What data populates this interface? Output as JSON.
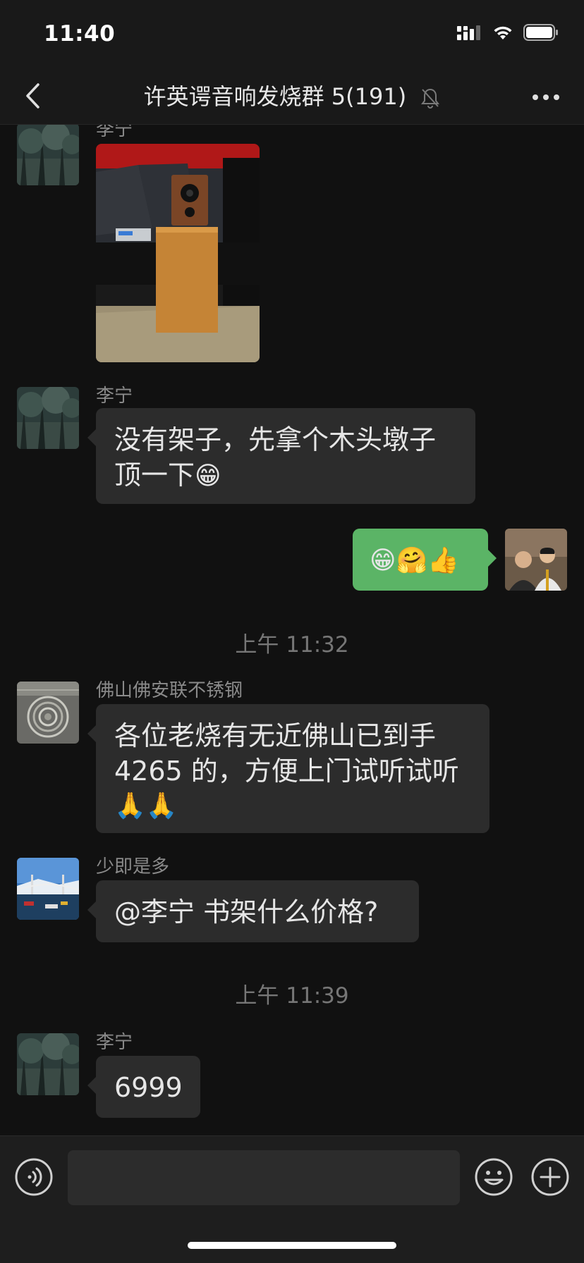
{
  "status_bar": {
    "time": "11:40",
    "icons": [
      "signal-icon",
      "wifi-icon",
      "battery-icon"
    ]
  },
  "nav": {
    "title": "许英谔音响发烧群 5(191)",
    "icons": [
      "back-chevron-icon",
      "mute-bell-icon",
      "more-dots-icon"
    ]
  },
  "messages": [
    {
      "sender": "李宁",
      "type": "image",
      "image_desc": "speaker-on-wooden-stand-photo"
    },
    {
      "sender": "李宁",
      "type": "text",
      "line1": "没有架子，先拿个木头墩子",
      "line2": "顶一下",
      "emoji": "😁"
    },
    {
      "sender": "me",
      "type": "emoji",
      "emojis": "😁🤗👍"
    },
    {
      "type": "timestamp",
      "text": "上午 11:32"
    },
    {
      "sender": "佛山佛安联不锈钢",
      "type": "text",
      "line1": "各位老烧有无近佛山已到手",
      "line2": "4265 的，方便上门试听试听",
      "line3": "🙏🙏"
    },
    {
      "sender": "少即是多",
      "type": "text",
      "text": "@李宁 书架什么价格?"
    },
    {
      "type": "timestamp",
      "text": "上午 11:39"
    },
    {
      "sender": "李宁",
      "type": "text",
      "text": "6999"
    }
  ],
  "input_bar": {
    "placeholder": "",
    "icons": [
      "voice-icon",
      "emoji-icon",
      "plus-icon"
    ]
  },
  "colors": {
    "background": "#111111",
    "bubble_other": "#2c2c2c",
    "bubble_self": "#5bb466",
    "name_text": "#8a8a8a",
    "timestamp_text": "#767676"
  }
}
